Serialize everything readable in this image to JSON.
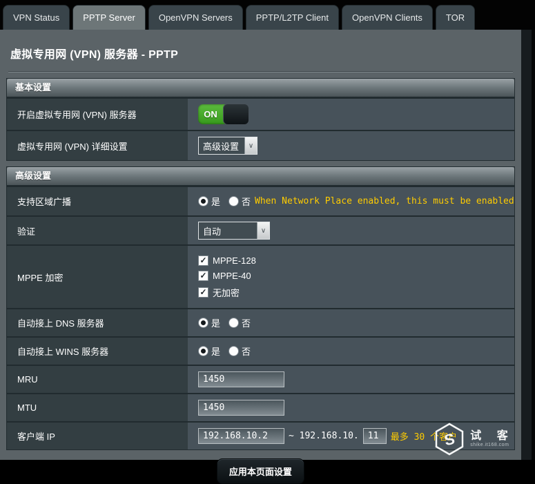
{
  "tabs": [
    {
      "label": "VPN Status",
      "active": false
    },
    {
      "label": "PPTP Server",
      "active": true
    },
    {
      "label": "OpenVPN Servers",
      "active": false
    },
    {
      "label": "PPTP/L2TP Client",
      "active": false
    },
    {
      "label": "OpenVPN Clients",
      "active": false
    },
    {
      "label": "TOR",
      "active": false
    }
  ],
  "page": {
    "title": "虚拟专用网 (VPN) 服务器 - PPTP"
  },
  "basic": {
    "header": "基本设置",
    "enable_label": "开启虚拟专用网 (VPN) 服务器",
    "toggle_state": "ON",
    "detail_label": "虚拟专用网 (VPN) 详细设置",
    "detail_value": "高级设置"
  },
  "advanced": {
    "header": "高级设置",
    "broadcast": {
      "label": "支持区域广播",
      "yes": "是",
      "no": "否",
      "selected": "是",
      "note": "When Network Place enabled, this must be enabled"
    },
    "auth": {
      "label": "验证",
      "value": "自动"
    },
    "mppe": {
      "label": "MPPE 加密",
      "options": [
        {
          "label": "MPPE-128",
          "checked": true
        },
        {
          "label": "MPPE-40",
          "checked": true
        },
        {
          "label": "无加密",
          "checked": true
        }
      ]
    },
    "dns": {
      "label": "自动接上 DNS 服务器",
      "yes": "是",
      "no": "否",
      "selected": "是"
    },
    "wins": {
      "label": "自动接上 WINS 服务器",
      "yes": "是",
      "no": "否",
      "selected": "是"
    },
    "mru": {
      "label": "MRU",
      "value": "1450"
    },
    "mtu": {
      "label": "MTU",
      "value": "1450"
    },
    "client_ip": {
      "label": "客户端 IP",
      "start_value": "192.168.10.2",
      "separator": "~ 192.168.10.",
      "end_value": "11",
      "note": "最多 30 个客户"
    }
  },
  "footer": {
    "apply_label": "应用本页面设置"
  },
  "watermark": {
    "text": "试 客",
    "url": "shike.it168.com"
  },
  "colors": {
    "toggle_green": "#45a81f",
    "warning_yellow": "#ffcc00",
    "content_bg": "#5b6367",
    "label_cell_bg": "#333e42",
    "value_cell_bg": "#47525a"
  }
}
